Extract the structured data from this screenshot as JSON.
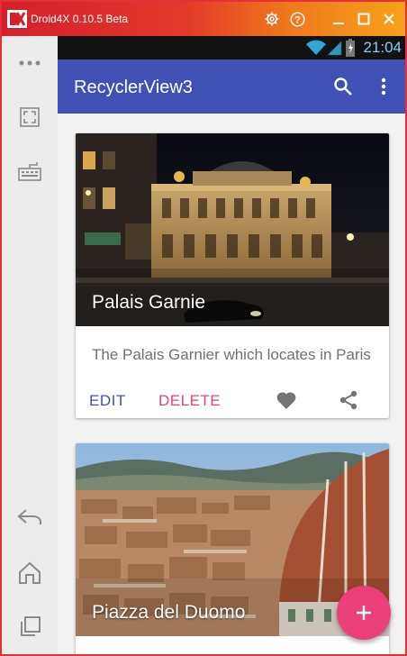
{
  "emulator": {
    "title": "Droid4X 0.10.5 Beta",
    "buttons": [
      "gear-icon",
      "help-icon",
      "minimize-icon",
      "maximize-icon",
      "close-icon"
    ],
    "sidebar_buttons": [
      "more-icon",
      "fullscreen-icon",
      "keyboard-icon",
      "back-icon",
      "home-icon",
      "recents-icon"
    ]
  },
  "status_bar": {
    "time": "21:04",
    "icons": [
      "wifi-icon",
      "signal-icon",
      "battery-icon"
    ]
  },
  "app_bar": {
    "title": "RecyclerView3",
    "actions": [
      "search-icon",
      "overflow-menu-icon"
    ],
    "color": "#3f51b5"
  },
  "cards": [
    {
      "title": "Palais Garnie",
      "description": "The Palais Garnier which locates in Paris",
      "edit_label": "EDIT",
      "delete_label": "DELETE",
      "icons": [
        "favorite-icon",
        "share-icon"
      ]
    },
    {
      "title": "Piazza del Duomo"
    }
  ],
  "fab": {
    "icon": "add-icon",
    "color": "#ec407a"
  },
  "colors": {
    "accent": "#ec407a",
    "primary": "#3f51b5",
    "edit": "#3f51b5"
  }
}
